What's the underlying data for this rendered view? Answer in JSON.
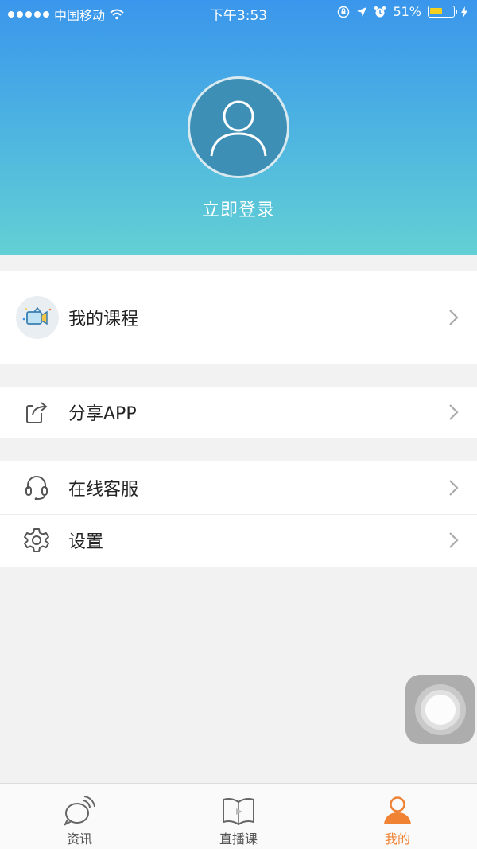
{
  "status_bar": {
    "carrier": "中国移动",
    "time": "下午3:53",
    "battery_percent": "51%",
    "battery_level": 0.51
  },
  "profile": {
    "login_label": "立即登录",
    "avatar_icon": "user-avatar-icon"
  },
  "menu": {
    "my_courses": {
      "label": "我的课程",
      "icon": "video-course-icon"
    },
    "share_app": {
      "label": "分享APP",
      "icon": "share-icon"
    },
    "online_service": {
      "label": "在线客服",
      "icon": "headset-icon"
    },
    "settings": {
      "label": "设置",
      "icon": "gear-icon"
    }
  },
  "tabs": [
    {
      "label": "资讯",
      "icon": "news-chat-icon",
      "active": false
    },
    {
      "label": "直播课",
      "icon": "book-play-icon",
      "active": false
    },
    {
      "label": "我的",
      "icon": "user-icon",
      "active": true
    }
  ],
  "colors": {
    "header_top": "#3a96ec",
    "header_bottom": "#62d0d4",
    "accent_active": "#f08233",
    "battery_fill": "#f5d020"
  }
}
